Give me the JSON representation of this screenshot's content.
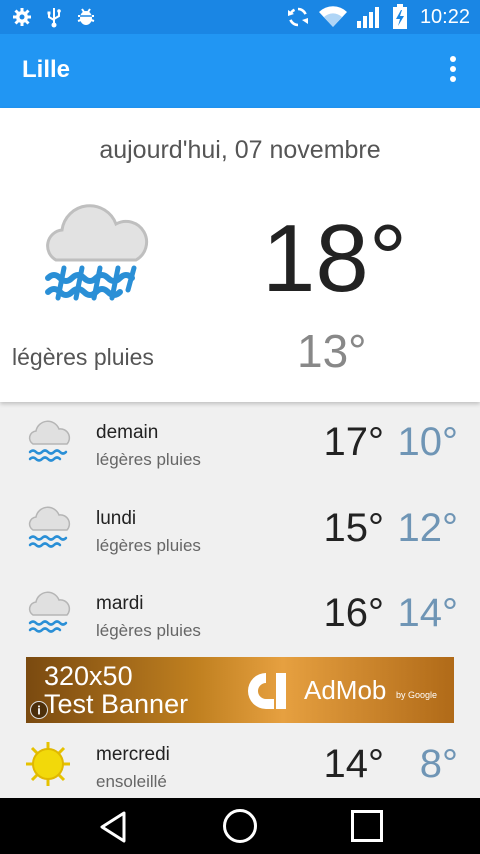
{
  "status_bar": {
    "time": "10:22",
    "left_icons": [
      "settings-gear-icon",
      "usb-icon",
      "android-debug-icon"
    ],
    "right_icons": [
      "sync-icon",
      "wifi-icon",
      "signal-icon",
      "battery-charging-icon"
    ]
  },
  "app_bar": {
    "title": "Lille",
    "menu_icon": "overflow-menu-icon"
  },
  "today": {
    "date": "aujourd'hui, 07 novembre",
    "icon": "light-rain-icon",
    "description": "légères pluies",
    "high": "18°",
    "low": "13°"
  },
  "forecast": [
    {
      "day": "demain",
      "description": "légères pluies",
      "high": "17°",
      "low": "10°",
      "icon": "light-rain-icon"
    },
    {
      "day": "lundi",
      "description": "légères pluies",
      "high": "15°",
      "low": "12°",
      "icon": "light-rain-icon"
    },
    {
      "day": "mardi",
      "description": "légères pluies",
      "high": "16°",
      "low": "14°",
      "icon": "light-rain-icon"
    },
    {
      "day": "mercredi",
      "description": "ensoleillé",
      "high": "14°",
      "low": "8°",
      "icon": "sun-icon"
    }
  ],
  "ad_banner": {
    "line1": "320x50",
    "line2": "Test Banner",
    "brand": "AdMob",
    "by": "by Google"
  },
  "nav_bar": {
    "icons": [
      "back-icon",
      "home-icon",
      "recent-apps-icon"
    ]
  },
  "colors": {
    "status_bar": "#1a86e4",
    "app_bar": "#2196f3",
    "low_temp": "#6f95b5",
    "list_bg": "#f0f0f0"
  }
}
